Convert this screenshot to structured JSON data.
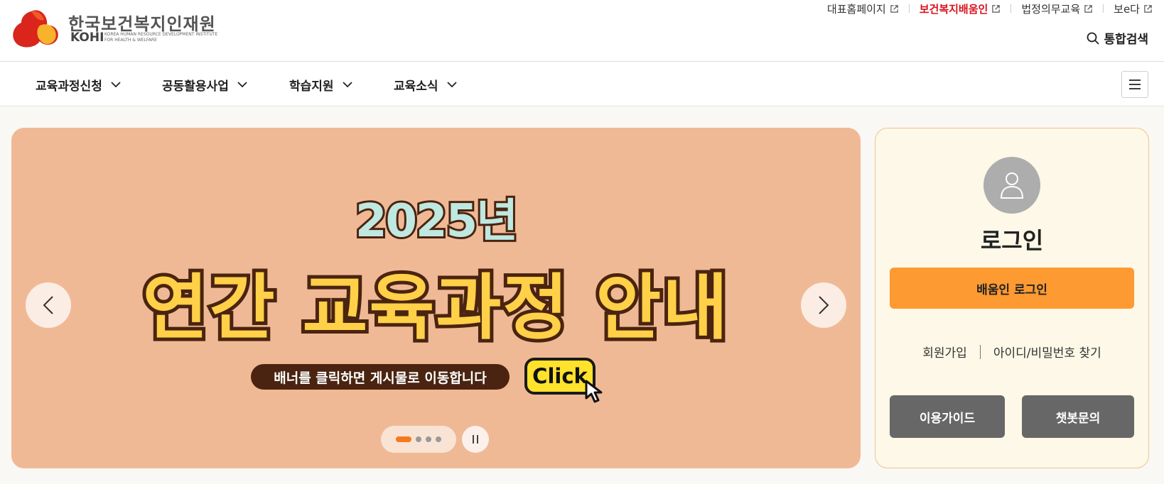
{
  "logo": {
    "name_ko": "한국보건복지인재원",
    "name_en": "KOHI",
    "sub_line1": "KOREA HUMAN RESOURCE DEVELOPMENT INSTITUTE",
    "sub_line2": "FOR HEALTH & WELFARE"
  },
  "top_links": [
    {
      "label": "대표홈페이지",
      "icon": "external-link-icon"
    },
    {
      "label": "보건복지배움인",
      "icon": "external-link-icon",
      "color": "#d7141f"
    },
    {
      "label": "법정의무교육",
      "icon": "external-link-icon"
    },
    {
      "label": "보e다",
      "icon": "external-link-icon"
    }
  ],
  "search": {
    "label": "통합검색",
    "icon": "search-icon"
  },
  "nav": {
    "items": [
      {
        "label": "교육과정신청",
        "icon": "chevron-down-icon"
      },
      {
        "label": "공동활용사업",
        "icon": "chevron-down-icon"
      },
      {
        "label": "학습지원",
        "icon": "chevron-down-icon"
      },
      {
        "label": "교육소식",
        "icon": "chevron-down-icon"
      }
    ],
    "menu_icon": "hamburger-menu-icon"
  },
  "banner": {
    "year": "2025년",
    "title": "연간 교육과정 안내",
    "subtitle": "배너를 클릭하면 게시물로 이동합니다",
    "click_label": "Click",
    "background": "#f0b995",
    "slide_count": 4,
    "active_slide": 1
  },
  "login": {
    "title": "로그인",
    "login_button": "배움인 로그인",
    "signup": "회원가입",
    "find_account": "아이디/비밀번호 찾기",
    "guide_button": "이용가이드",
    "chatbot_button": "챗봇문의",
    "accent": "#fd9a32"
  }
}
